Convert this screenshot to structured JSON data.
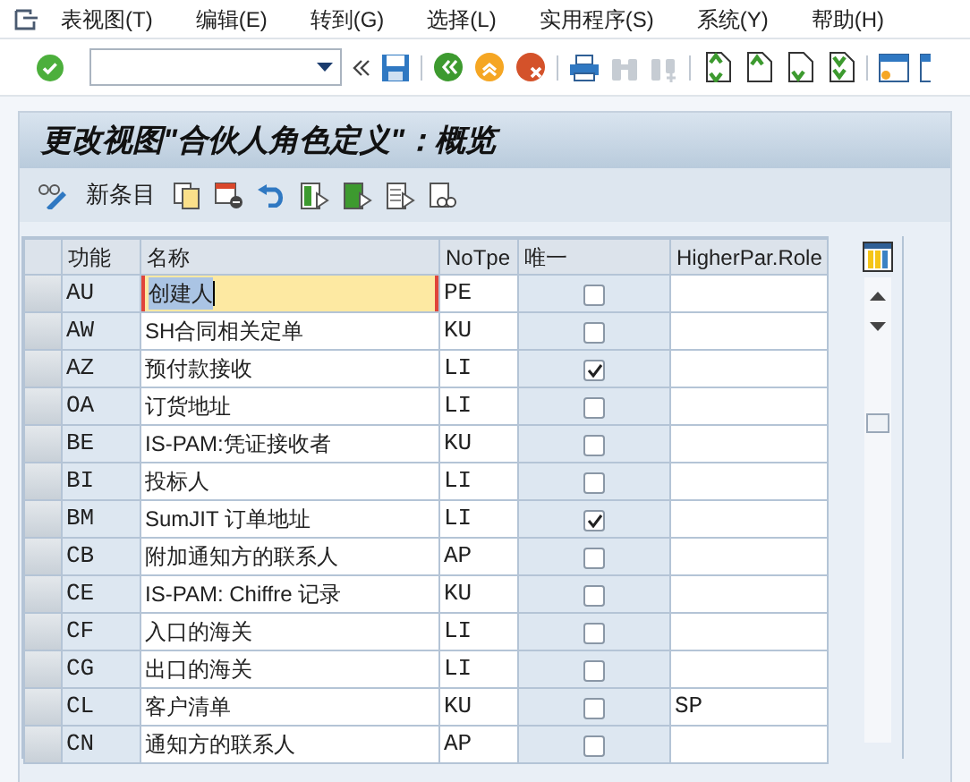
{
  "menu": [
    "表视图(T)",
    "编辑(E)",
    "转到(G)",
    "选择(L)",
    "实用程序(S)",
    "系统(Y)",
    "帮助(H)"
  ],
  "title": "更改视图\"合伙人角色定义\"：概览",
  "app_toolbar": {
    "new_entries": "新条目"
  },
  "table": {
    "columns": [
      "功能",
      "名称",
      "NoTpe",
      "唯一",
      "HigherPar.Role"
    ],
    "rows": [
      {
        "function": "AU",
        "name": "创建人",
        "notype": "PE",
        "unique": false,
        "focused": true
      },
      {
        "function": "AW",
        "name": "SH合同相关定单",
        "notype": "KU",
        "unique": false,
        "focused": false
      },
      {
        "function": "AZ",
        "name": "预付款接收",
        "notype": "LI",
        "unique": true,
        "focused": false
      },
      {
        "function": "OA",
        "name": "订货地址",
        "notype": "LI",
        "unique": false,
        "focused": false
      },
      {
        "function": "BE",
        "name": "IS-PAM:凭证接收者",
        "notype": "KU",
        "unique": false,
        "focused": false
      },
      {
        "function": "BI",
        "name": "投标人",
        "notype": "LI",
        "unique": false,
        "focused": false
      },
      {
        "function": "BM",
        "name": "SumJIT 订单地址",
        "notype": "LI",
        "unique": true,
        "focused": false
      },
      {
        "function": "CB",
        "name": "附加通知方的联系人",
        "notype": "AP",
        "unique": false,
        "focused": false
      },
      {
        "function": "CE",
        "name": "IS-PAM: Chiffre 记录",
        "notype": "KU",
        "unique": false,
        "focused": false
      },
      {
        "function": "CF",
        "name": "入口的海关",
        "notype": "LI",
        "unique": false,
        "focused": false
      },
      {
        "function": "CG",
        "name": "出口的海关",
        "notype": "LI",
        "unique": false,
        "focused": false
      },
      {
        "function": "CL",
        "name": "客户清单",
        "notype": "KU",
        "unique": false,
        "higher": "SP",
        "focused": false
      },
      {
        "function": "CN",
        "name": "通知方的联系人",
        "notype": "AP",
        "unique": false,
        "focused": false
      }
    ]
  }
}
